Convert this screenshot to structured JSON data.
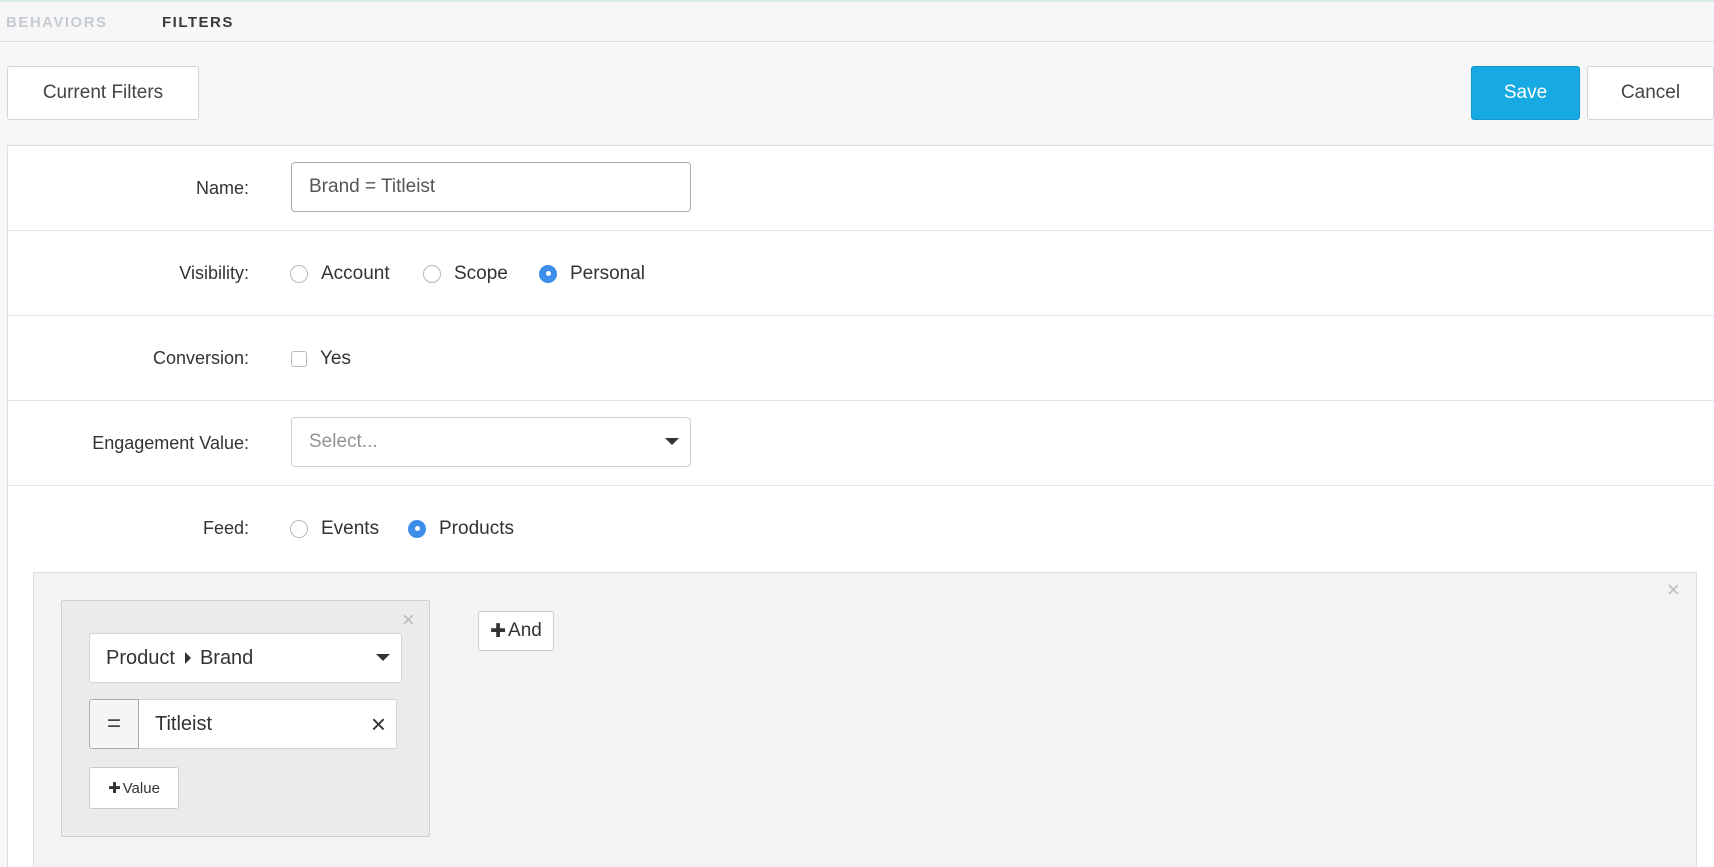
{
  "tabs": [
    {
      "label": "BEHAVIORS",
      "active": false
    },
    {
      "label": "FILTERS",
      "active": true
    }
  ],
  "toolbar": {
    "current_filters_label": "Current Filters",
    "save_label": "Save",
    "cancel_label": "Cancel"
  },
  "form": {
    "name": {
      "label": "Name:",
      "value": "Brand = Titleist"
    },
    "visibility": {
      "label": "Visibility:",
      "options": [
        "Account",
        "Scope",
        "Personal"
      ],
      "selected": "Personal"
    },
    "conversion": {
      "label": "Conversion:",
      "option": "Yes",
      "checked": false
    },
    "engagement": {
      "label": "Engagement Value:",
      "placeholder": "Select..."
    },
    "feed": {
      "label": "Feed:",
      "options": [
        "Events",
        "Products"
      ],
      "selected": "Products"
    }
  },
  "filter": {
    "field_path": [
      "Product",
      "Brand"
    ],
    "operator": "=",
    "value": "Titleist",
    "add_value_label": "Value",
    "add_and_label": "And",
    "plus_symbol": "✚",
    "close_symbol": "×"
  },
  "colors": {
    "accent": "#17a9e1",
    "radio_selected": "#3d8ee8"
  },
  "icons": {
    "dropdown": "caret-down-icon",
    "path_separator": "caret-right-icon",
    "clear": "close-icon",
    "add": "plus-icon"
  }
}
